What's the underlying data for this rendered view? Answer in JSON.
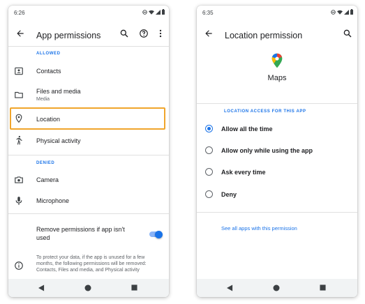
{
  "left_screen": {
    "status_time": "6:26",
    "title": "App permissions",
    "allowed_label": "ALLOWED",
    "allowed": [
      {
        "label": "Contacts",
        "icon": "contacts-icon"
      },
      {
        "label": "Files and media",
        "sub": "Media",
        "icon": "folder-icon"
      },
      {
        "label": "Location",
        "icon": "location-pin-icon",
        "highlighted": true
      },
      {
        "label": "Physical activity",
        "icon": "walking-icon"
      }
    ],
    "denied_label": "DENIED",
    "denied": [
      {
        "label": "Camera",
        "icon": "camera-icon"
      },
      {
        "label": "Microphone",
        "icon": "microphone-icon"
      }
    ],
    "remove_permissions": {
      "line1": "Remove permissions if app isn't",
      "line2": "used",
      "enabled": true
    },
    "info_text": {
      "line1": "To protect your data, if the app is unused for a few",
      "line2": "months, the following permissions will be removed:",
      "line3": "Contacts, Files and media, and Physical activity"
    }
  },
  "right_screen": {
    "status_time": "6:35",
    "title": "Location permission",
    "app_name": "Maps",
    "section_label": "LOCATION ACCESS FOR THIS APP",
    "options": [
      {
        "label": "Allow all the time",
        "selected": true
      },
      {
        "label": "Allow only while using the app",
        "selected": false
      },
      {
        "label": "Ask every time",
        "selected": false
      },
      {
        "label": "Deny",
        "selected": false
      }
    ],
    "see_all_link": "See all apps with this permission"
  },
  "colors": {
    "accent": "#1a73e8",
    "highlight_border": "#f0a52b",
    "text_primary": "#202124",
    "text_secondary": "#5f6368"
  }
}
